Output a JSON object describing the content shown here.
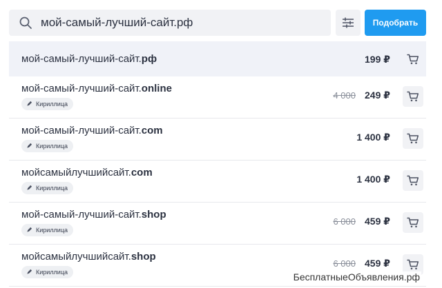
{
  "search": {
    "value": "мой-самый-лучший-сайт.рф",
    "icon": "search-icon"
  },
  "toolbar": {
    "filter_icon": "filter-icon",
    "pick_label": "Подобрать",
    "accent": "#1f9bf0"
  },
  "results": [
    {
      "name": "мой-самый-лучший-сайт.",
      "zone": "рф",
      "badge": "",
      "old_price": "",
      "price": "199 ₽"
    },
    {
      "name": "мой-самый-лучший-сайт.",
      "zone": "online",
      "badge": "Кириллица",
      "old_price": "4 000",
      "price": "249 ₽"
    },
    {
      "name": "мой-самый-лучший-сайт.",
      "zone": "com",
      "badge": "Кириллица",
      "old_price": "",
      "price": "1 400 ₽"
    },
    {
      "name": "мойсамыйлучшийсайт.",
      "zone": "com",
      "badge": "Кириллица",
      "old_price": "",
      "price": "1 400 ₽"
    },
    {
      "name": "мой-самый-лучший-сайт.",
      "zone": "shop",
      "badge": "Кириллица",
      "old_price": "6 000",
      "price": "459 ₽"
    },
    {
      "name": "мойсамыйлучшийсайт.",
      "zone": "shop",
      "badge": "Кириллица",
      "old_price": "6 000",
      "price": "459 ₽"
    }
  ],
  "watermark": "БесплатныеОбъявления.рф"
}
